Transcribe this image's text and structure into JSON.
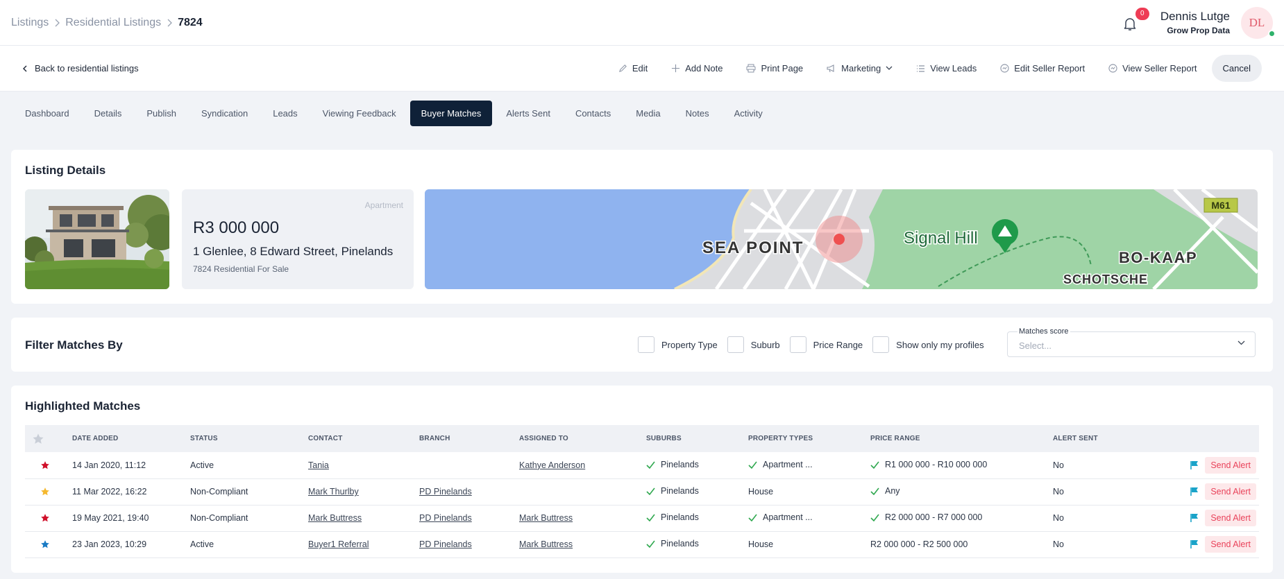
{
  "breadcrumb": {
    "items": [
      "Listings",
      "Residential Listings"
    ],
    "current": "7824"
  },
  "notifications": {
    "count": "0"
  },
  "user": {
    "name": "Dennis Lutge",
    "company": "Grow Prop Data",
    "initials": "DL"
  },
  "actionbar": {
    "back_label": "Back to residential listings",
    "edit": "Edit",
    "add_note": "Add Note",
    "print_page": "Print Page",
    "marketing": "Marketing",
    "view_leads": "View Leads",
    "edit_seller_report": "Edit Seller Report",
    "view_seller_report": "View Seller Report",
    "cancel": "Cancel"
  },
  "tabs": [
    "Dashboard",
    "Details",
    "Publish",
    "Syndication",
    "Leads",
    "Viewing Feedback",
    "Buyer Matches",
    "Alerts Sent",
    "Contacts",
    "Media",
    "Notes",
    "Activity"
  ],
  "active_tab": "Buyer Matches",
  "listing": {
    "title": "Listing Details",
    "property_type": "Apartment",
    "price": "R3 000 000",
    "address": "1 Glenlee, 8 Edward Street, Pinelands",
    "ref": "7824 Residential For Sale",
    "map_labels": {
      "area1": "SEA POINT",
      "area2": "Signal Hill",
      "area3": "BO-KAAP",
      "area4": "SCHOTSCHE",
      "road": "M61"
    }
  },
  "filter": {
    "title": "Filter Matches By",
    "checks": [
      "Property Type",
      "Suburb",
      "Price Range",
      "Show only my profiles"
    ],
    "score_label": "Matches score",
    "score_placeholder": "Select..."
  },
  "matches": {
    "title": "Highlighted Matches",
    "columns": [
      "DATE ADDED",
      "STATUS",
      "CONTACT",
      "BRANCH",
      "ASSIGNED TO",
      "SUBURBS",
      "PROPERTY TYPES",
      "PRICE RANGE",
      "ALERT SENT"
    ],
    "send_label": "Send Alert",
    "colors": {
      "red_star": "#d0102a",
      "gold_star": "#f5b82e",
      "blue_star": "#1a7bc4",
      "check": "#2fa84f",
      "flag": "#1aa3c9"
    },
    "rows": [
      {
        "star": "red",
        "date": "14 Jan 2020, 11:12",
        "status": "Active",
        "contact": "Tania",
        "branch": "",
        "assigned": "Kathye Anderson",
        "suburb": "Pinelands",
        "ptype": "Apartment ...",
        "ptype_ok": true,
        "price": "R1 000 000 - R10 000 000",
        "price_ok": true,
        "alert": "No"
      },
      {
        "star": "gold",
        "date": "11 Mar 2022, 16:22",
        "status": "Non-Compliant",
        "contact": "Mark Thurlby",
        "branch": "PD Pinelands",
        "assigned": "",
        "suburb": "Pinelands",
        "ptype": "House",
        "ptype_ok": false,
        "price": "Any",
        "price_ok": true,
        "alert": "No"
      },
      {
        "star": "red",
        "date": "19 May 2021, 19:40",
        "status": "Non-Compliant",
        "contact": "Mark Buttress",
        "branch": "PD Pinelands",
        "assigned": "Mark Buttress",
        "suburb": "Pinelands",
        "ptype": "Apartment ...",
        "ptype_ok": true,
        "price": "R2 000 000 - R7 000 000",
        "price_ok": true,
        "alert": "No"
      },
      {
        "star": "blue",
        "date": "23 Jan 2023, 10:29",
        "status": "Active",
        "contact": "Buyer1 Referral",
        "branch": "PD Pinelands",
        "assigned": "Mark Buttress",
        "suburb": "Pinelands",
        "ptype": "House",
        "ptype_ok": false,
        "price": "R2 000 000 - R2 500 000",
        "price_ok": false,
        "alert": "No"
      }
    ]
  }
}
